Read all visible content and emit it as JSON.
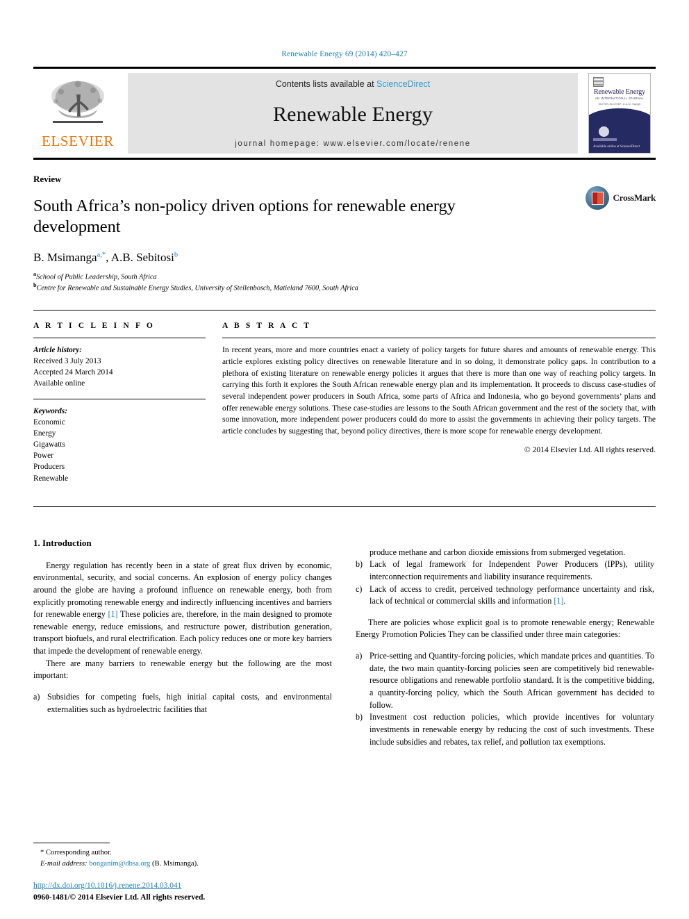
{
  "running_head": "Renewable Energy 69 (2014) 420–427",
  "masthead": {
    "publisher_logo_text": "ELSEVIER",
    "contents_prefix": "Contents lists available at ",
    "contents_link": "ScienceDirect",
    "journal_title": "Renewable Energy",
    "homepage": "journal homepage: www.elsevier.com/locate/renene",
    "cover": {
      "title": "Renewable Energy",
      "subtitle": "AN INTERNATIONAL JOURNAL",
      "editors": "EDITOR-IN-CHIEF: A.A.M. Sayigh",
      "footer": "Available online at\nScienceDirect"
    }
  },
  "article": {
    "doctype": "Review",
    "title": "South Africa’s non-policy driven options for renewable energy development",
    "authors": "B. Msimanga",
    "author1_sup": "a,*",
    "authors2": ", A.B. Sebitosi",
    "author2_sup": "b",
    "affiliations": [
      {
        "mark": "a",
        "text": "School of Public Leadership, South Africa"
      },
      {
        "mark": "b",
        "text": "Centre for Renewable and Sustainable Energy Studies, University of Stellenbosch, Matieland 7600, South Africa"
      }
    ],
    "crossmark_label": "CrossMark"
  },
  "info": {
    "heading": "A R T I C L E   I N F O",
    "history_label": "Article history:",
    "history": [
      "Received 3 July 2013",
      "Accepted 24 March 2014",
      "Available online"
    ],
    "keywords_label": "Keywords:",
    "keywords": [
      "Economic",
      "Energy",
      "Gigawatts",
      "Power",
      "Producers",
      "Renewable"
    ]
  },
  "abstract": {
    "heading": "A B S T R A C T",
    "text": "In recent years, more and more countries enact a variety of policy targets for future shares and amounts of renewable energy. This article explores existing policy directives on renewable literature and in so doing, it demonstrate policy gaps. In contribution to a plethora of existing literature on renewable energy policies it argues that there is more than one way of reaching policy targets. In carrying this forth it explores the South African renewable energy plan and its implementation. It proceeds to discuss case-studies of several independent power producers in South Africa, some parts of Africa and Indonesia, who go beyond governments’ plans and offer renewable energy solutions. These case-studies are lessons to the South African government and the rest of the society that, with some innovation, more independent power producers could do more to assist the governments in achieving their policy targets. The article concludes by suggesting that, beyond policy directives, there is more scope for renewable energy development.",
    "copyright": "© 2014 Elsevier Ltd. All rights reserved."
  },
  "body": {
    "section_heading": "1. Introduction",
    "left": {
      "p1_a": "Energy regulation has recently been in a state of great flux driven by economic, environmental, security, and social concerns. An explosion of energy policy changes around the globe are having a profound influence on renewable energy, both from explicitly promoting renewable energy and indirectly influencing incentives and barriers for renewable energy ",
      "p1_cite": "[1]",
      "p1_b": " These policies are, therefore, in the main designed to promote renewable energy, reduce emissions, and restructure power, distribution generation, transport biofuels, and rural electrification. Each policy reduces one or more key barriers that impede the development of renewable energy.",
      "p2": "There are many barriers to renewable energy but the following are the most important:",
      "item_a_mark": "a)",
      "item_a": "Subsidies for competing fuels, high initial capital costs, and environmental externalities such as hydroelectric facilities that"
    },
    "right": {
      "item_a_cont": "produce methane and carbon dioxide emissions from submerged vegetation.",
      "item_b_mark": "b)",
      "item_b": "Lack of legal framework for Independent Power Producers (IPPs), utility interconnection requirements and liability insurance requirements.",
      "item_c_mark": "c)",
      "item_c_a": "Lack of access to credit, perceived technology performance uncertainty and risk, lack of technical or commercial skills and information ",
      "item_c_cite": "[1]",
      "item_c_b": ".",
      "p3": "There are policies whose explicit goal is to promote renewable energy; Renewable Energy Promotion Policies They can be classified under three main categories:",
      "item2_a_mark": "a)",
      "item2_a": "Price-setting and Quantity-forcing policies, which mandate prices and quantities. To date, the two main quantity-forcing policies seen are competitively bid renewable-resource obligations and renewable portfolio standard. It is the competitive bidding, a quantity-forcing policy, which the South African government has decided to follow.",
      "item2_b_mark": "b)",
      "item2_b": "Investment cost reduction policies, which provide incentives for voluntary investments in renewable energy by reducing the cost of such investments. These include subsidies and rebates, tax relief, and pollution tax exemptions."
    }
  },
  "footer": {
    "corresponding": "* Corresponding author.",
    "email_label": "E-mail address: ",
    "email": "bonganim@dbsa.org",
    "email_suffix": " (B. Msimanga).",
    "doi": "http://dx.doi.org/10.1016/j.renene.2014.03.041",
    "issn": "0960-1481/© 2014 Elsevier Ltd. All rights reserved."
  },
  "colors": {
    "link": "#1b7fb5",
    "sciencedirect": "#2e9ad0",
    "elsevier_orange": "#ec7404",
    "cover_navy": "#262a63"
  }
}
